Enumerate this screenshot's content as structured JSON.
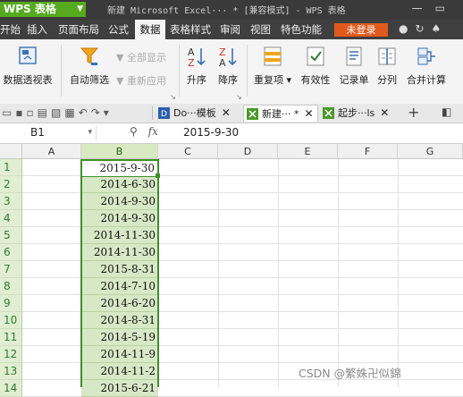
{
  "titlebar": {
    "app_name": "WPS 表格",
    "title": "新建 Microsoft Excel··· * [兼容模式] - WPS 表格"
  },
  "menu": {
    "items": [
      "开始",
      "插入",
      "页面布局",
      "公式",
      "数据",
      "表格样式",
      "审阅",
      "视图",
      "特色功能"
    ],
    "active": "数据",
    "login": "未登录"
  },
  "ribbon": {
    "pivot": "数据透视表",
    "autofilter": "自动筛选",
    "show_all": "全部显示",
    "reapply": "重新应用",
    "sort_asc": "升序",
    "sort_desc": "降序",
    "duplicates": "重复项",
    "validity": "有效性",
    "record": "记录单",
    "split": "分列",
    "consolidate": "合并计算"
  },
  "tabs": [
    {
      "label": "Do···模板",
      "icon": "wps-doc-icon"
    },
    {
      "label": "新建··· *",
      "icon": "spreadsheet-icon"
    },
    {
      "label": "起步···ls",
      "icon": "spreadsheet-icon"
    }
  ],
  "formula_bar": {
    "cell_ref": "B1",
    "fx": "fx",
    "value": "2015-9-30"
  },
  "sheet": {
    "columns": [
      "A",
      "B",
      "C",
      "D",
      "E",
      "F",
      "G"
    ],
    "rows": [
      "1",
      "2",
      "3",
      "4",
      "5",
      "6",
      "7",
      "8",
      "9",
      "10",
      "11",
      "12",
      "13",
      "14"
    ],
    "column_b": [
      "2015-9-30",
      "2014-6-30",
      "2014-9-30",
      "2014-9-30",
      "2014-11-30",
      "2014-11-30",
      "2015-8-31",
      "2014-7-10",
      "2014-6-20",
      "2014-8-31",
      "2014-5-19",
      "2014-11-9",
      "2014-11-2",
      "2015-6-21"
    ]
  },
  "watermark": "CSDN @繁姝卍似錦",
  "colors": {
    "accent_green": "#3f8f2a",
    "login_orange": "#e05a1e",
    "dark_bar": "#3f3f3f"
  }
}
